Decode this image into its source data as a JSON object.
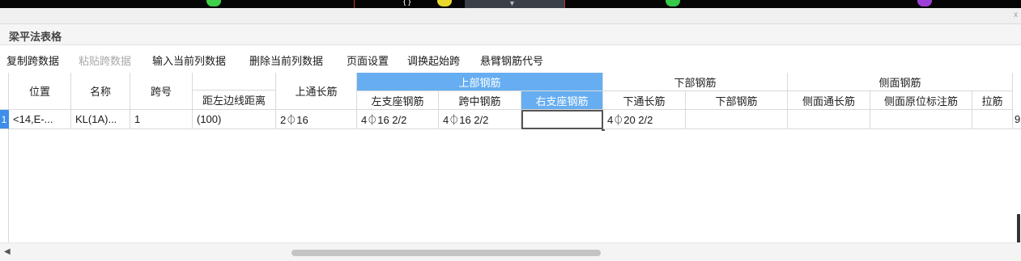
{
  "window": {
    "panel_title": "梁平法表格",
    "close_glyph": "x"
  },
  "canvas": {
    "dropdown_arrow": "▼",
    "glyph_1": "{ }"
  },
  "toolbar": {
    "items": [
      {
        "label": "复制跨数据",
        "enabled": true
      },
      {
        "label": "粘贴跨数据",
        "enabled": false
      },
      {
        "label": "输入当前列数据",
        "enabled": true
      },
      {
        "label": "删除当前列数据",
        "enabled": true
      },
      {
        "label": "页面设置",
        "enabled": true
      },
      {
        "label": "调换起始跨",
        "enabled": true
      },
      {
        "label": "悬臂钢筋代号",
        "enabled": true
      }
    ]
  },
  "table": {
    "headers": {
      "position": "位置",
      "name": "名称",
      "span_no": "跨号",
      "left_edge_distance": "距左边线距离",
      "top_through_bar": "上通长筋",
      "top_reinforcement": "上部钢筋",
      "left_support_bar": "左支座钢筋",
      "mid_span_bar": "跨中钢筋",
      "right_support_bar": "右支座钢筋",
      "bottom_reinforcement": "下部钢筋",
      "bottom_through_bar": "下通长筋",
      "bottom_bar": "下部钢筋",
      "side_reinforcement": "侧面钢筋",
      "side_through_bar": "侧面通长筋",
      "side_original_annotation": "侧面原位标注筋",
      "tie_bar": "拉筋"
    },
    "rows": [
      {
        "row_number": "1",
        "position": "<14,E-...",
        "name": "KL(1A)...",
        "span_no": "1",
        "left_edge_distance": "(100)",
        "top_through_bar": "2⏀16",
        "left_support_bar": "4⏀16 2/2",
        "mid_span_bar": "4⏀16 2/2",
        "right_support_bar": "",
        "bottom_through_bar": "4⏀20 2/2",
        "bottom_bar": "",
        "side_through_bar": "",
        "side_original_annotation": "",
        "tie_bar": "",
        "overflow_glyph": "9"
      }
    ]
  },
  "scrollbar": {
    "left_arrow": "◀"
  },
  "colors": {
    "selected_header": "#66aef1",
    "row_number_bg": "#3c8ee8",
    "panel_title_bg": "#f5f5f5"
  }
}
